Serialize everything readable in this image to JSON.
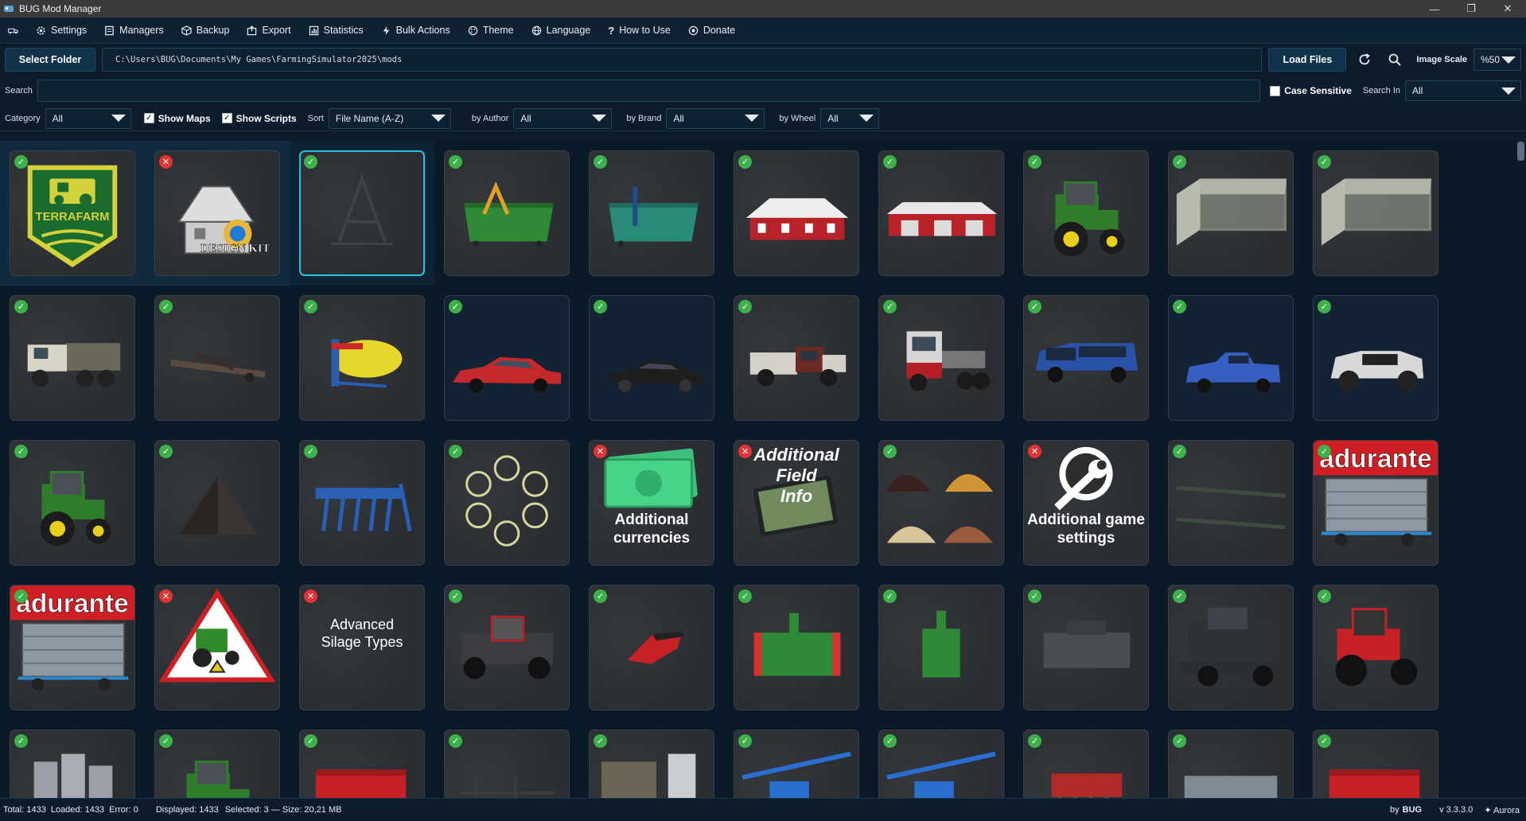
{
  "window": {
    "title": "BUG Mod Manager",
    "min": "—",
    "max": "❐",
    "close": "✕"
  },
  "menu": [
    {
      "label": "Settings",
      "icon": "gear-icon"
    },
    {
      "label": "Managers",
      "icon": "book-icon"
    },
    {
      "label": "Backup",
      "icon": "box-icon"
    },
    {
      "label": "Export",
      "icon": "export-icon"
    },
    {
      "label": "Statistics",
      "icon": "stats-icon"
    },
    {
      "label": "Bulk Actions",
      "icon": "bolt-icon"
    },
    {
      "label": "Theme",
      "icon": "palette-icon"
    },
    {
      "label": "Language",
      "icon": "globe-icon"
    },
    {
      "label": "How to Use",
      "icon": "question-icon"
    },
    {
      "label": "Donate",
      "icon": "donate-icon"
    }
  ],
  "folder": {
    "select_label": "Select Folder",
    "path": "C:\\Users\\BUG\\Documents\\My Games\\FarmingSimulator2025\\mods",
    "load_label": "Load Files",
    "image_scale_label": "Image Scale",
    "image_scale_value": "%50"
  },
  "search": {
    "label": "Search",
    "value": "",
    "case_sensitive_label": "Case Sensitive",
    "search_in_label": "Search In",
    "search_in_value": "All"
  },
  "filters": {
    "category_label": "Category",
    "category_value": "All",
    "show_maps_label": "Show Maps",
    "show_scripts_label": "Show Scripts",
    "sort_label": "Sort",
    "sort_value": "File Name (A-Z)",
    "author_label": "by Author",
    "author_value": "All",
    "brand_label": "by Brand",
    "brand_value": "All",
    "wheel_label": "by Wheel",
    "wheel_value": "All"
  },
  "cards": [
    {
      "status": "ok",
      "art": "terrafarm-logo",
      "text": "TERRAFARM"
    },
    {
      "status": "err",
      "art": "design-kit",
      "text": "DESIGN KIT"
    },
    {
      "status": "ok",
      "art": "frame",
      "text": "",
      "selected": true
    },
    {
      "status": "ok",
      "art": "green-bin",
      "text": ""
    },
    {
      "status": "ok",
      "art": "teal-bin",
      "text": ""
    },
    {
      "status": "ok",
      "art": "red-barn",
      "text": ""
    },
    {
      "status": "ok",
      "art": "red-barn2",
      "text": ""
    },
    {
      "status": "ok",
      "art": "green-tractor",
      "text": ""
    },
    {
      "status": "ok",
      "art": "shed",
      "text": ""
    },
    {
      "status": "ok",
      "art": "shed",
      "text": ""
    },
    {
      "status": "ok",
      "art": "old-truck",
      "text": ""
    },
    {
      "status": "ok",
      "art": "trailer-flat",
      "text": ""
    },
    {
      "status": "ok",
      "art": "yellow-tank",
      "text": ""
    },
    {
      "status": "ok",
      "art": "red-car",
      "text": "",
      "dark": true
    },
    {
      "status": "ok",
      "art": "black-car",
      "text": "",
      "dark": true
    },
    {
      "status": "ok",
      "art": "pickup-red",
      "text": ""
    },
    {
      "status": "ok",
      "art": "semi-truck",
      "text": ""
    },
    {
      "status": "ok",
      "art": "blue-suv",
      "text": ""
    },
    {
      "status": "ok",
      "art": "blue-pickup",
      "text": "",
      "dark": true
    },
    {
      "status": "ok",
      "art": "offroad",
      "text": "",
      "dark": true
    },
    {
      "status": "ok",
      "art": "green-tractor",
      "text": ""
    },
    {
      "status": "ok",
      "art": "a-frame",
      "text": ""
    },
    {
      "status": "ok",
      "art": "blue-cultivator",
      "text": ""
    },
    {
      "status": "ok",
      "art": "icon-wheel",
      "text": ""
    },
    {
      "status": "err",
      "art": "money",
      "text": "Additional currencies"
    },
    {
      "status": "err",
      "art": "field-info",
      "text": "Additional Field Info"
    },
    {
      "status": "ok",
      "art": "piles",
      "text": ""
    },
    {
      "status": "err",
      "art": "wrench",
      "text": "Additional game settings"
    },
    {
      "status": "ok",
      "art": "rods",
      "text": ""
    },
    {
      "status": "ok",
      "art": "adurante",
      "text": "adurante"
    },
    {
      "status": "ok",
      "art": "adurante",
      "text": "adurante"
    },
    {
      "status": "err",
      "art": "warning-tractor",
      "text": ""
    },
    {
      "status": "err",
      "art": "text-only",
      "text": "Advanced Silage Types"
    },
    {
      "status": "ok",
      "art": "mower-tractor",
      "text": ""
    },
    {
      "status": "ok",
      "art": "red-blade",
      "text": ""
    },
    {
      "status": "ok",
      "art": "green-weight",
      "text": ""
    },
    {
      "status": "ok",
      "art": "green-weight2",
      "text": ""
    },
    {
      "status": "ok",
      "art": "grey-weight",
      "text": ""
    },
    {
      "status": "ok",
      "art": "combine",
      "text": ""
    },
    {
      "status": "ok",
      "art": "red-tractor",
      "text": ""
    },
    {
      "status": "ok",
      "art": "silos",
      "text": ""
    },
    {
      "status": "ok",
      "art": "green-tractor",
      "text": ""
    },
    {
      "status": "ok",
      "art": "red-spreader",
      "text": ""
    },
    {
      "status": "ok",
      "art": "dark-bars",
      "text": ""
    },
    {
      "status": "ok",
      "art": "shed-small",
      "text": ""
    },
    {
      "status": "ok",
      "art": "blue-sprayer",
      "text": ""
    },
    {
      "status": "ok",
      "art": "blue-sprayer",
      "text": ""
    },
    {
      "status": "ok",
      "art": "red-seeder",
      "text": ""
    },
    {
      "status": "ok",
      "art": "grey-trailer",
      "text": ""
    },
    {
      "status": "ok",
      "art": "red-spreader",
      "text": ""
    }
  ],
  "statusbar": {
    "total": "Total: 1433",
    "loaded": "Loaded: 1433",
    "error": "Error: 0",
    "displayed": "Displayed: 1433",
    "selected": "Selected: 3 — Size: 20,21 MB",
    "by": "by",
    "author": "BUG",
    "version": "v 3.3.3.0",
    "theme": "✦ Aurora"
  },
  "colors": {
    "ok": "#3db24a",
    "err": "#e03535",
    "accent": "#25c4dd"
  }
}
